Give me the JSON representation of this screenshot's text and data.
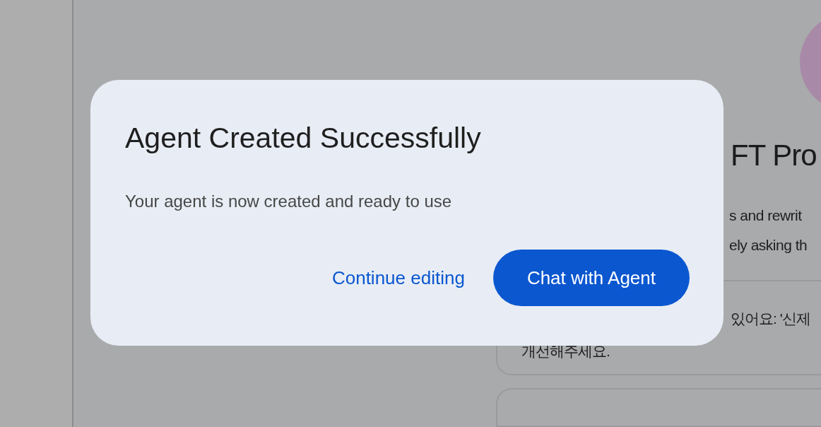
{
  "background": {
    "heading": "FT Pro",
    "description_lines": [
      "s and rewrit",
      "ely asking th"
    ],
    "prompt_card": {
      "lines": [
        "있어요: '신제",
        "개선해주세요."
      ]
    }
  },
  "dialog": {
    "title": "Agent Created Successfully",
    "message": "Your agent is now created and ready to use",
    "buttons": [
      {
        "label": "Continue editing",
        "kind": "text"
      },
      {
        "label": "Chat with Agent",
        "kind": "filled"
      }
    ]
  }
}
